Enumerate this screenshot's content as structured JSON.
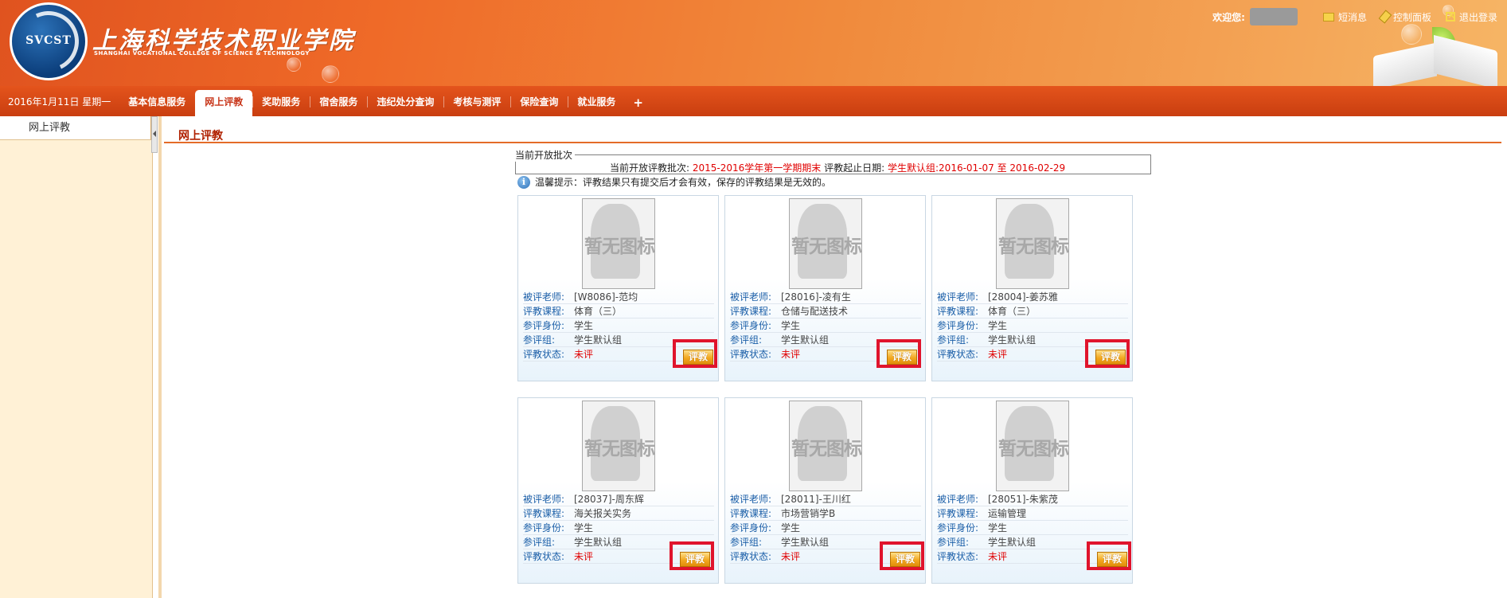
{
  "header": {
    "school_cn": "上海科学技术职业学院",
    "school_en": "SHANGHAI VOCATIONAL COLLEGE OF SCIENCE & TECHNOLOGY",
    "logo_text": "SVCST",
    "welcome": "欢迎您:",
    "links": {
      "messages": "短消息",
      "control_panel": "控制面板",
      "logout": "退出登录"
    }
  },
  "nav": {
    "date": "2016年1月11日 星期一",
    "items": [
      "基本信息服务",
      "网上评教",
      "奖助服务",
      "宿舍服务",
      "违纪处分查询",
      "考核与测评",
      "保险查询",
      "就业服务"
    ],
    "active_index": 1,
    "plus": "+"
  },
  "sidebar": {
    "item": "网上评教"
  },
  "main": {
    "title": "网上评教",
    "batch_legend": "当前开放批次",
    "batch_prefix": "当前开放评教批次:",
    "batch_name": "2015-2016学年第一学期期末",
    "date_prefix": "评教起止日期:",
    "date_range": "学生默认组:2016-01-07 至 2016-02-29",
    "tip": "温馨提示：评教结果只有提交后才会有效，保存的评教结果是无效的。",
    "tip_icon": "i"
  },
  "card_labels": {
    "teacher": "被评老师:",
    "course": "评教课程:",
    "role": "参评身份:",
    "group": "参评组:",
    "status": "评教状态:"
  },
  "placeholder_text": "暂无图标",
  "eval_button": "评教",
  "cards": [
    {
      "teacher": "[W8086]-范均",
      "course": "体育（三）",
      "role": "学生",
      "group": "学生默认组",
      "status": "未评"
    },
    {
      "teacher": "[28016]-凌有生",
      "course": "仓储与配送技术",
      "role": "学生",
      "group": "学生默认组",
      "status": "未评"
    },
    {
      "teacher": "[28004]-姜苏雅",
      "course": "体育（三）",
      "role": "学生",
      "group": "学生默认组",
      "status": "未评"
    },
    {
      "teacher": "[28037]-周东辉",
      "course": "海关报关实务",
      "role": "学生",
      "group": "学生默认组",
      "status": "未评"
    },
    {
      "teacher": "[28011]-王川红",
      "course": "市场营销学B",
      "role": "学生",
      "group": "学生默认组",
      "status": "未评"
    },
    {
      "teacher": "[28051]-朱紫茂",
      "course": "运输管理",
      "role": "学生",
      "group": "学生默认组",
      "status": "未评"
    }
  ],
  "colors": {
    "header_orange": "#ef6a28",
    "nav_red": "#c93e10",
    "label_blue": "#1b5fa8",
    "status_red": "#e00000",
    "highlight_red": "#e0142c"
  }
}
